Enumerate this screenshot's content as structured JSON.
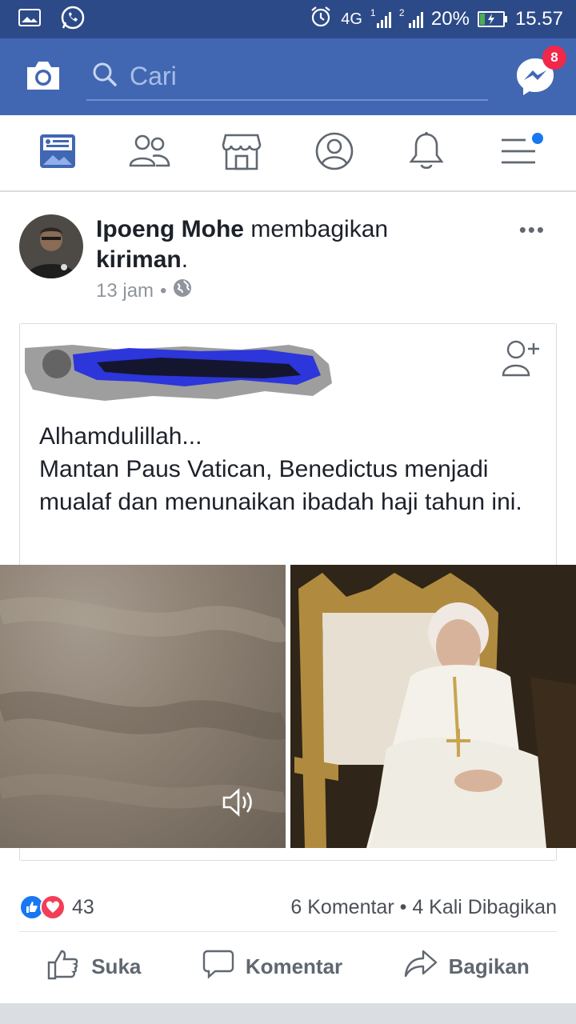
{
  "statusbar": {
    "network": "4G",
    "sim1": "1",
    "sim2": "2",
    "battery": "20%",
    "battery_level": 0.2,
    "time": "15.57"
  },
  "appbar": {
    "search_placeholder": "Cari",
    "messenger_badge": "8"
  },
  "post": {
    "author": "Ipoeng Mohe",
    "action": "membagikan",
    "object": "kiriman",
    "punct": ".",
    "time": "13 jam",
    "separator": "•",
    "shared_text": "Alhamdulillah...\nMantan Paus Vatican, Benedictus menjadi mualaf dan menunaikan ibadah haji tahun ini."
  },
  "reactions": {
    "count": "43",
    "comments": "6 Komentar",
    "bullet": "•",
    "shares": "4 Kali Dibagikan"
  },
  "actions": {
    "like": "Suka",
    "comment": "Komentar",
    "share": "Bagikan"
  },
  "colors": {
    "statusbar": "#2d4a88",
    "header": "#4267b2",
    "like_blue": "#1877f2",
    "love_red": "#f33e58",
    "badge_red": "#f02849"
  }
}
